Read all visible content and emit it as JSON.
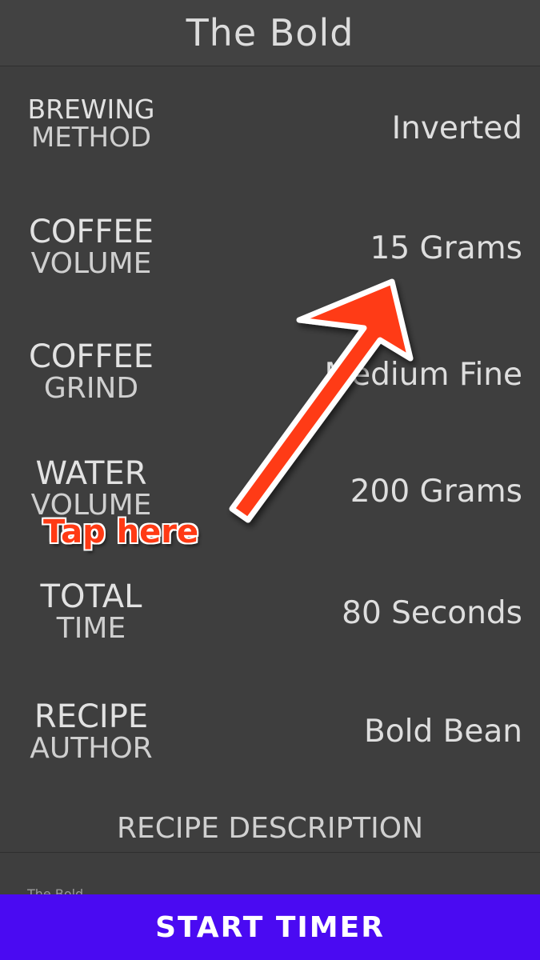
{
  "header": {
    "title": "The Bold"
  },
  "rows": [
    {
      "label_top": "BREWING",
      "label_bottom": "METHOD",
      "value": "Inverted"
    },
    {
      "label_top": "COFFEE",
      "label_bottom": "VOLUME",
      "value": "15 Grams"
    },
    {
      "label_top": "COFFEE",
      "label_bottom": "GRIND",
      "value": "Medium Fine"
    },
    {
      "label_top": "WATER",
      "label_bottom": "VOLUME",
      "value": "200 Grams"
    },
    {
      "label_top": "TOTAL",
      "label_bottom": "TIME",
      "value": "80 Seconds"
    },
    {
      "label_top": "RECIPE",
      "label_bottom": "AUTHOR",
      "value": "Bold Bean"
    }
  ],
  "description": {
    "title": "RECIPE DESCRIPTION",
    "text": "The Bold ..."
  },
  "start_button": {
    "label": "START TIMER"
  },
  "annotation": {
    "text": "Tap here",
    "color": "#ff3a14"
  },
  "colors": {
    "background": "#3e3e3e",
    "button": "#4a0af2"
  }
}
